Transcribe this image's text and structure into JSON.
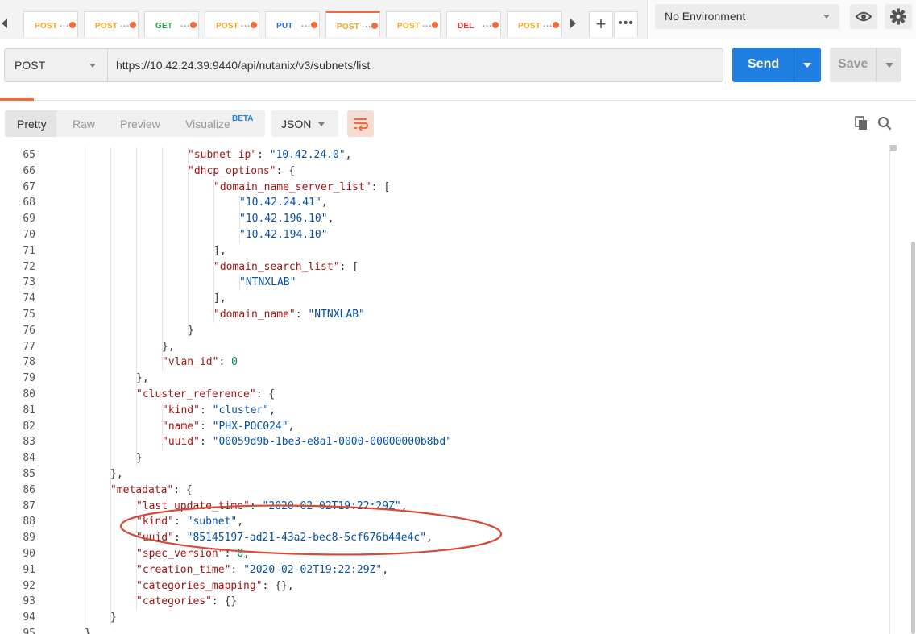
{
  "tabs": [
    {
      "method": "POST",
      "cls": "m-post"
    },
    {
      "method": "POST",
      "cls": "m-post"
    },
    {
      "method": "GET",
      "cls": "m-get"
    },
    {
      "method": "POST",
      "cls": "m-post"
    },
    {
      "method": "PUT",
      "cls": "m-put"
    },
    {
      "method": "POST",
      "cls": "m-post",
      "active": true
    },
    {
      "method": "POST",
      "cls": "m-post"
    },
    {
      "method": "DEL",
      "cls": "m-del"
    },
    {
      "method": "POST",
      "cls": "m-post"
    }
  ],
  "tab_ellipsis": "...",
  "more_label": "•••",
  "plus_label": "+",
  "environment": {
    "selected": "No Environment"
  },
  "request": {
    "method": "POST",
    "url": "https://10.42.24.39:9440/api/nutanix/v3/subnets/list",
    "send_label": "Send",
    "save_label": "Save"
  },
  "response": {
    "view_tabs": [
      "Pretty",
      "Raw",
      "Preview",
      "Visualize"
    ],
    "beta_badge": "BETA",
    "format": "JSON"
  },
  "colors": {
    "accent": "#f26b3a",
    "send": "#1f7fe0",
    "key": "#a31515",
    "string": "#0451a5",
    "number": "#098658"
  },
  "code_lines": [
    {
      "n": "65",
      "indent": 5,
      "t": [
        [
          "k",
          "\"subnet_ip\""
        ],
        [
          "p",
          ": "
        ],
        [
          "s",
          "\"10.42.24.0\""
        ],
        [
          "p",
          ","
        ]
      ]
    },
    {
      "n": "66",
      "indent": 5,
      "t": [
        [
          "k",
          "\"dhcp_options\""
        ],
        [
          "p",
          ": {"
        ]
      ]
    },
    {
      "n": "67",
      "indent": 6,
      "t": [
        [
          "k",
          "\"domain_name_server_list\""
        ],
        [
          "p",
          ": ["
        ]
      ]
    },
    {
      "n": "68",
      "indent": 7,
      "t": [
        [
          "s",
          "\"10.42.24.41\""
        ],
        [
          "p",
          ","
        ]
      ]
    },
    {
      "n": "69",
      "indent": 7,
      "t": [
        [
          "s",
          "\"10.42.196.10\""
        ],
        [
          "p",
          ","
        ]
      ]
    },
    {
      "n": "70",
      "indent": 7,
      "t": [
        [
          "s",
          "\"10.42.194.10\""
        ]
      ]
    },
    {
      "n": "71",
      "indent": 6,
      "t": [
        [
          "p",
          "],"
        ]
      ]
    },
    {
      "n": "72",
      "indent": 6,
      "t": [
        [
          "k",
          "\"domain_search_list\""
        ],
        [
          "p",
          ": ["
        ]
      ]
    },
    {
      "n": "73",
      "indent": 7,
      "t": [
        [
          "s",
          "\"NTNXLAB\""
        ]
      ]
    },
    {
      "n": "74",
      "indent": 6,
      "t": [
        [
          "p",
          "],"
        ]
      ]
    },
    {
      "n": "75",
      "indent": 6,
      "t": [
        [
          "k",
          "\"domain_name\""
        ],
        [
          "p",
          ": "
        ],
        [
          "s",
          "\"NTNXLAB\""
        ]
      ]
    },
    {
      "n": "76",
      "indent": 5,
      "t": [
        [
          "p",
          "}"
        ]
      ]
    },
    {
      "n": "77",
      "indent": 4,
      "t": [
        [
          "p",
          "},"
        ]
      ]
    },
    {
      "n": "78",
      "indent": 4,
      "t": [
        [
          "k",
          "\"vlan_id\""
        ],
        [
          "p",
          ": "
        ],
        [
          "n",
          "0"
        ]
      ]
    },
    {
      "n": "79",
      "indent": 3,
      "t": [
        [
          "p",
          "},"
        ]
      ]
    },
    {
      "n": "80",
      "indent": 3,
      "t": [
        [
          "k",
          "\"cluster_reference\""
        ],
        [
          "p",
          ": {"
        ]
      ]
    },
    {
      "n": "81",
      "indent": 4,
      "t": [
        [
          "k",
          "\"kind\""
        ],
        [
          "p",
          ": "
        ],
        [
          "s",
          "\"cluster\""
        ],
        [
          "p",
          ","
        ]
      ]
    },
    {
      "n": "82",
      "indent": 4,
      "t": [
        [
          "k",
          "\"name\""
        ],
        [
          "p",
          ": "
        ],
        [
          "s",
          "\"PHX-POC024\""
        ],
        [
          "p",
          ","
        ]
      ]
    },
    {
      "n": "83",
      "indent": 4,
      "t": [
        [
          "k",
          "\"uuid\""
        ],
        [
          "p",
          ": "
        ],
        [
          "s",
          "\"00059d9b-1be3-e8a1-0000-00000000b8bd\""
        ]
      ]
    },
    {
      "n": "84",
      "indent": 3,
      "t": [
        [
          "p",
          "}"
        ]
      ]
    },
    {
      "n": "85",
      "indent": 2,
      "t": [
        [
          "p",
          "},"
        ]
      ]
    },
    {
      "n": "86",
      "indent": 2,
      "t": [
        [
          "k",
          "\"metadata\""
        ],
        [
          "p",
          ": {"
        ]
      ]
    },
    {
      "n": "87",
      "indent": 3,
      "t": [
        [
          "k",
          "\"last_update_time\""
        ],
        [
          "p",
          ": "
        ],
        [
          "s",
          "\"2020-02-02T19:22:29Z\""
        ],
        [
          "p",
          ","
        ]
      ]
    },
    {
      "n": "88",
      "indent": 3,
      "t": [
        [
          "k",
          "\"kind\""
        ],
        [
          "p",
          ": "
        ],
        [
          "s",
          "\"subnet\""
        ],
        [
          "p",
          ","
        ]
      ]
    },
    {
      "n": "89",
      "indent": 3,
      "t": [
        [
          "k",
          "\"uuid\""
        ],
        [
          "p",
          ": "
        ],
        [
          "s",
          "\"85145197-ad21-43a2-bec8-5cf676b44e4c\""
        ],
        [
          "p",
          ","
        ]
      ]
    },
    {
      "n": "90",
      "indent": 3,
      "t": [
        [
          "k",
          "\"spec_version\""
        ],
        [
          "p",
          ": "
        ],
        [
          "n",
          "0"
        ],
        [
          "p",
          ","
        ]
      ]
    },
    {
      "n": "91",
      "indent": 3,
      "t": [
        [
          "k",
          "\"creation_time\""
        ],
        [
          "p",
          ": "
        ],
        [
          "s",
          "\"2020-02-02T19:22:29Z\""
        ],
        [
          "p",
          ","
        ]
      ]
    },
    {
      "n": "92",
      "indent": 3,
      "t": [
        [
          "k",
          "\"categories_mapping\""
        ],
        [
          "p",
          ": {},"
        ]
      ]
    },
    {
      "n": "93",
      "indent": 3,
      "t": [
        [
          "k",
          "\"categories\""
        ],
        [
          "p",
          ": {}"
        ]
      ]
    },
    {
      "n": "94",
      "indent": 2,
      "t": [
        [
          "p",
          "}"
        ]
      ]
    },
    {
      "n": "95",
      "indent": 1,
      "t": [
        [
          "p",
          "},"
        ]
      ]
    }
  ]
}
